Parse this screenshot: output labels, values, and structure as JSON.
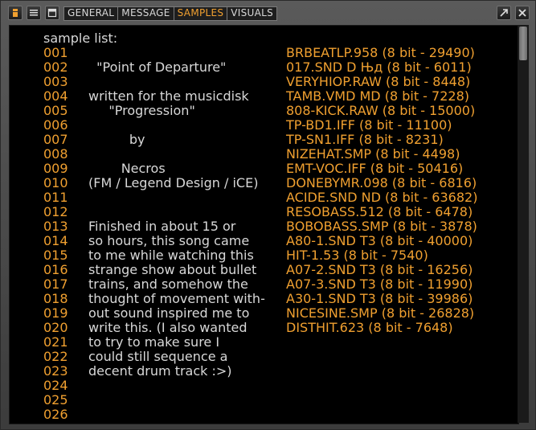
{
  "tabs": [
    {
      "label": "GENERAL",
      "active": false
    },
    {
      "label": "MESSAGE",
      "active": false
    },
    {
      "label": "SAMPLES",
      "active": true
    },
    {
      "label": "VISUALS",
      "active": false
    }
  ],
  "colors": {
    "accent": "#f0a030",
    "text": "#d8d8d8",
    "background": "#000000"
  },
  "list_title": "sample list:",
  "rows": [
    {
      "num": "001",
      "message": "",
      "sample": "BRBEATLP.958 (8 bit - 29490)"
    },
    {
      "num": "002",
      "message": "  \"Point of Departure\"",
      "sample": "017.SND D Њд (8 bit - 6011)"
    },
    {
      "num": "003",
      "message": "",
      "sample": "VERYHIOP.RAW (8 bit - 8448)"
    },
    {
      "num": "004",
      "message": "written for the musicdisk",
      "sample": "TAMB.VMD MD (8 bit - 7228)"
    },
    {
      "num": "005",
      "message": "     \"Progression\"",
      "sample": "808-KICK.RAW (8 bit - 15000)"
    },
    {
      "num": "006",
      "message": "",
      "sample": "TP-BD1.IFF (8 bit - 11100)"
    },
    {
      "num": "007",
      "message": "          by",
      "sample": "TP-SN1.IFF (8 bit - 8231)"
    },
    {
      "num": "008",
      "message": "",
      "sample": "NIZEHAT.SMP (8 bit - 4498)"
    },
    {
      "num": "009",
      "message": "        Necros",
      "sample": "EMT-VOC.IFF (8 bit - 50416)"
    },
    {
      "num": "010",
      "message": "(FM / Legend Design / iCE)",
      "sample": "DONEBYMR.098 (8 bit - 6816)"
    },
    {
      "num": "011",
      "message": "",
      "sample": "ACIDE.SND ND (8 bit - 63682)"
    },
    {
      "num": "012",
      "message": "",
      "sample": "RESOBASS.512 (8 bit - 6478)"
    },
    {
      "num": "013",
      "message": "Finished in about 15 or",
      "sample": "BOBOBASS.SMP (8 bit - 3878)"
    },
    {
      "num": "014",
      "message": "so hours, this song came",
      "sample": "A80-1.SND T3 (8 bit - 40000)"
    },
    {
      "num": "015",
      "message": "to me while watching this",
      "sample": "HIT-1.53 (8 bit - 7540)"
    },
    {
      "num": "016",
      "message": "strange show about bullet",
      "sample": "A07-2.SND T3 (8 bit - 16256)"
    },
    {
      "num": "017",
      "message": "trains, and somehow the",
      "sample": "A07-3.SND T3 (8 bit - 11990)"
    },
    {
      "num": "018",
      "message": "thought of movement with-",
      "sample": "A30-1.SND T3 (8 bit - 39986)"
    },
    {
      "num": "019",
      "message": "out sound inspired me to",
      "sample": "NICESINE.SMP (8 bit - 26828)"
    },
    {
      "num": "020",
      "message": "write this. (I also wanted",
      "sample": "DISTHIT.623 (8 bit - 7648)"
    },
    {
      "num": "021",
      "message": "to try to make sure I",
      "sample": ""
    },
    {
      "num": "022",
      "message": "could still sequence a",
      "sample": ""
    },
    {
      "num": "023",
      "message": "decent drum track :>)",
      "sample": ""
    },
    {
      "num": "024",
      "message": "",
      "sample": ""
    },
    {
      "num": "025",
      "message": "",
      "sample": ""
    },
    {
      "num": "026",
      "message": "",
      "sample": ""
    }
  ]
}
